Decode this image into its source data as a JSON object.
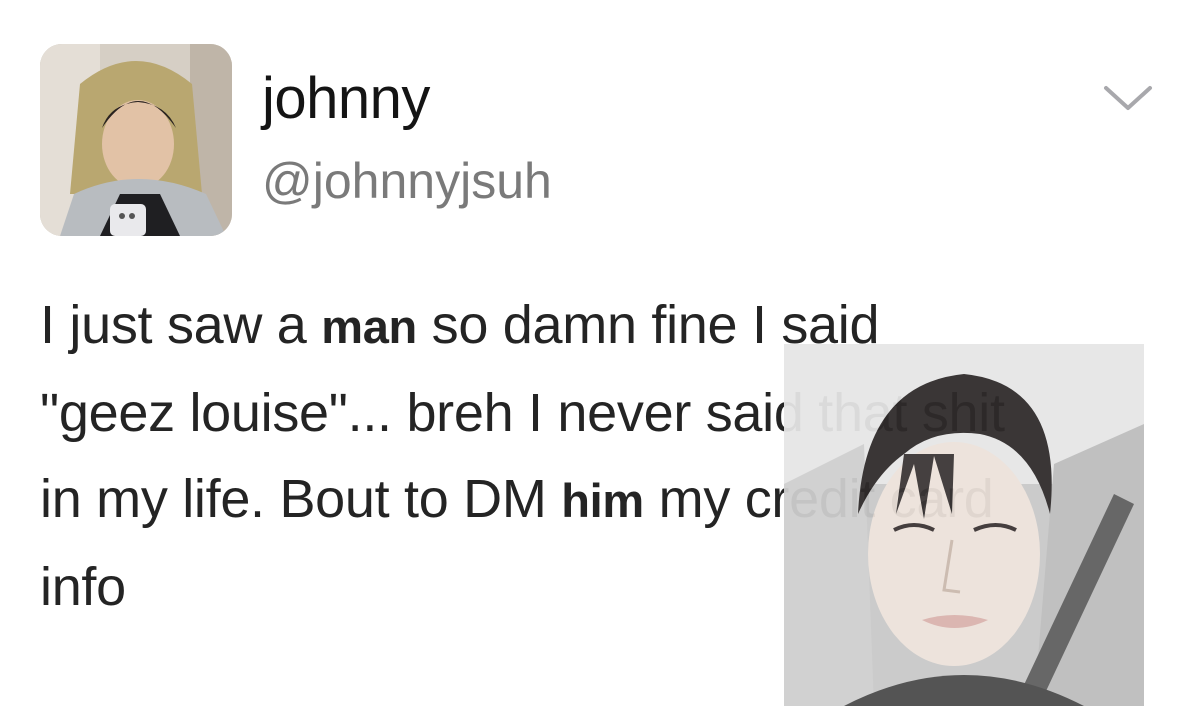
{
  "tweet": {
    "display_name": "johnny",
    "handle": "@johnnyjsuh",
    "text_lines": [
      {
        "parts": [
          "I just saw a ",
          "man",
          " so damn fine I said"
        ]
      },
      {
        "parts": [
          "\"geez louise\"... breh I never said that shit"
        ]
      },
      {
        "parts": [
          "in my life. Bout to DM ",
          "him",
          " my credit card"
        ]
      },
      {
        "parts": [
          "info"
        ]
      }
    ]
  },
  "icons": {
    "menu": "chevron-down-icon"
  },
  "colors": {
    "background": "#ffffff",
    "name": "#141414",
    "handle": "#7a7a7a",
    "text": "#242424"
  }
}
